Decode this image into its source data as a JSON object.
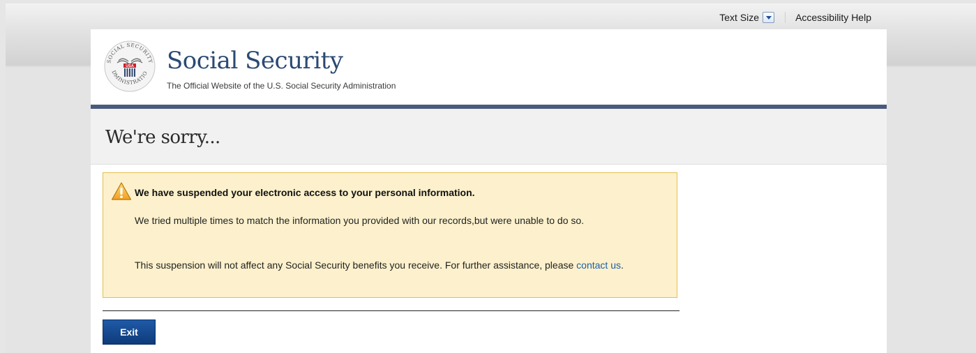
{
  "utility": {
    "text_size_label": "Text Size",
    "accessibility_label": "Accessibility Help"
  },
  "header": {
    "site_title": "Social Security",
    "tagline": "The Official Website of the U.S. Social Security Administration",
    "seal_icon": "ssa-seal-logo",
    "seal_text": "SOCIAL SECURITY ADMINISTRATION USA"
  },
  "page": {
    "title": "We're sorry..."
  },
  "alert": {
    "icon": "warning-icon",
    "heading": "We have suspended your electronic access to your personal information.",
    "paragraph1": "We tried multiple times to match the information you provided with our records,but were unable to do so.",
    "paragraph2_text": "This suspension will not affect any Social Security benefits you receive. For further assistance, please ",
    "contact_link": "contact us",
    "paragraph2_end": "."
  },
  "actions": {
    "exit_label": "Exit"
  },
  "colors": {
    "brand_blue": "#2b4a73",
    "rule_blue": "#4a5a7c",
    "alert_bg": "#fcf1cc",
    "alert_border": "#e2c04f",
    "button_blue": "#1f5aa8",
    "link_blue": "#1c5ea8"
  }
}
